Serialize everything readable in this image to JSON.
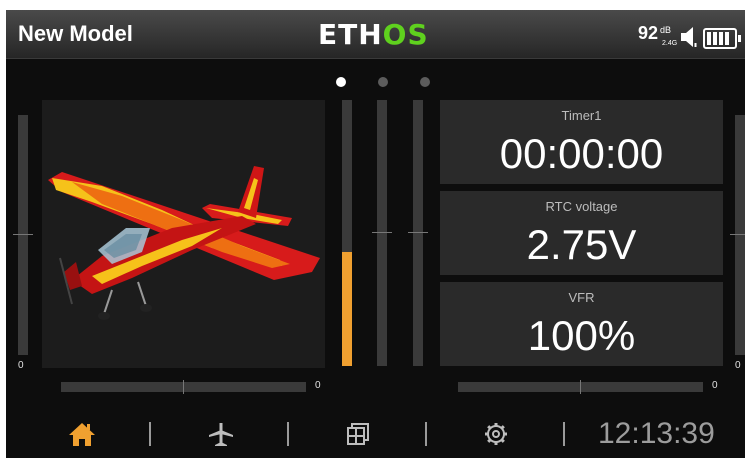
{
  "header": {
    "model_name": "New Model",
    "logo_prefix": "ETH",
    "logo_suffix": "OS",
    "rssi_value": "92",
    "rssi_unit": "dB",
    "rssi_band": "2.4G"
  },
  "pages": {
    "count": 3,
    "active_index": 0
  },
  "trims": {
    "left_vertical_value": "0",
    "left_horizontal_value": "0",
    "right_vertical_value": "0",
    "right_horizontal_value": "0"
  },
  "throttle_slider": {
    "level": 0.43,
    "color": "#f0a030"
  },
  "widgets": [
    {
      "title": "Timer1",
      "value": "00:00:00"
    },
    {
      "title": "RTC voltage",
      "value": "2.75V"
    },
    {
      "title": "VFR",
      "value": "100%"
    }
  ],
  "footer": {
    "icons": [
      "home-icon",
      "airplane-icon",
      "displays-icon",
      "settings-icon"
    ],
    "active_color": "#f0a030",
    "clock": "12:13:39"
  },
  "colors": {
    "logo_accent": "#5fd11e",
    "accent": "#f0a030"
  }
}
